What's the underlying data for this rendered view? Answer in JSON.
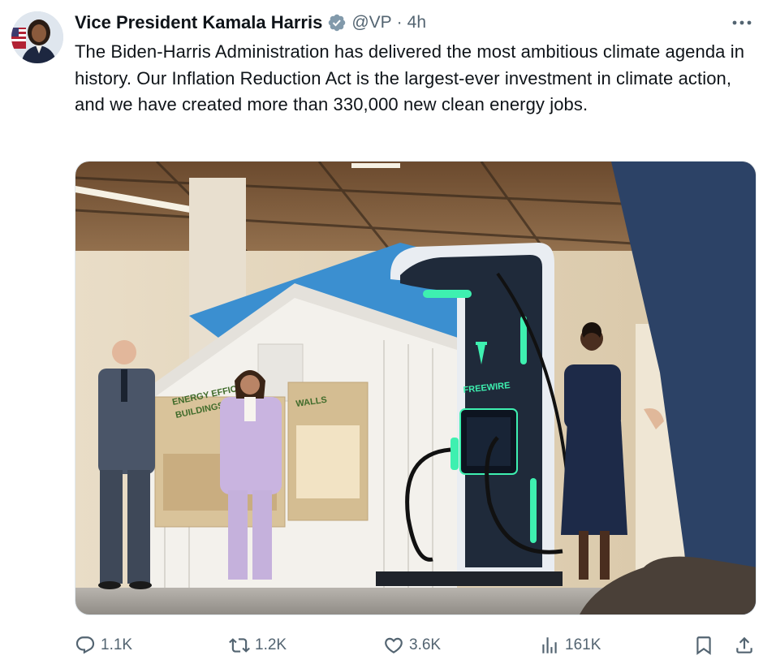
{
  "tweet": {
    "author_name": "Vice President Kamala Harris",
    "handle": "@VP",
    "separator": "·",
    "time": "4h",
    "text": "The Biden-Harris Administration has delivered the most ambitious climate agenda in history. Our Inflation Reduction Act is the largest-ever investment in climate action, and we have created more than 330,000 new clean energy jobs."
  },
  "media": {
    "sign_efficient": "ENERGY EFFICIENT",
    "sign_buildings": "BUILDINGS",
    "sign_walls": "WALLS",
    "charger_brand": "FREEWIRE"
  },
  "actions": {
    "replies": "1.1K",
    "reposts": "1.2K",
    "likes": "3.6K",
    "views": "161K"
  },
  "icons": {
    "verified": "verified-badge-icon",
    "more": "more-options-icon",
    "reply": "reply-icon",
    "repost": "repost-icon",
    "like": "heart-icon",
    "views": "views-icon",
    "bookmark": "bookmark-icon",
    "share": "share-icon"
  },
  "colors": {
    "text_primary": "#0f1419",
    "text_secondary": "#536471",
    "verified_badge": "#829aab"
  }
}
